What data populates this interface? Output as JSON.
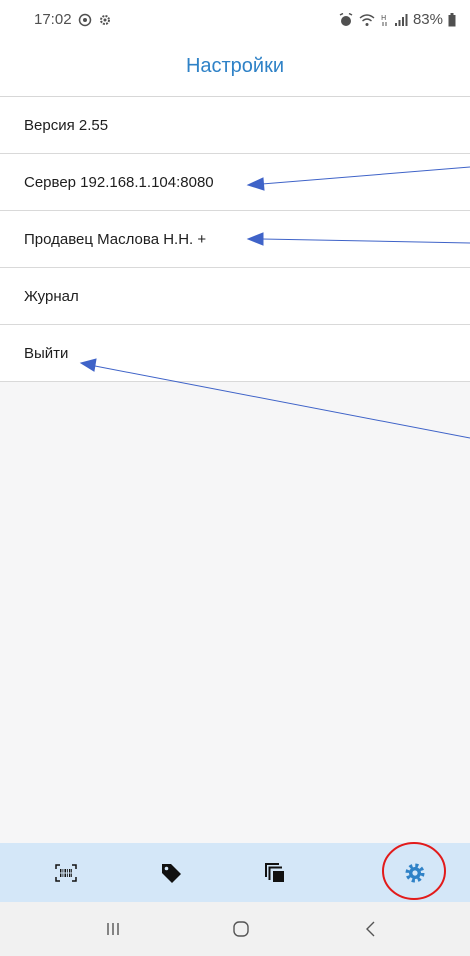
{
  "status_bar": {
    "time": "17:02",
    "icons_left": [
      "whatsapp-icon",
      "settings-small-icon"
    ],
    "icons_right": [
      "alarm-icon",
      "wifi-icon",
      "h-plus-icon",
      "signal-icon"
    ],
    "battery": "83%"
  },
  "header": {
    "title": "Настройки"
  },
  "menu": {
    "items": [
      {
        "label": "Версия 2.55"
      },
      {
        "label": "Сервер 192.168.1.104:8080"
      },
      {
        "label": "Продавец Маслова Н.Н. +"
      },
      {
        "label": "Журнал"
      },
      {
        "label": "Выйти"
      }
    ]
  },
  "bottom_nav": {
    "items": [
      {
        "icon": "barcode-scan-icon"
      },
      {
        "icon": "tag-icon"
      },
      {
        "icon": "copy-icon"
      },
      {
        "icon": "settings-icon",
        "active": true
      }
    ]
  },
  "system_nav": {
    "items": [
      {
        "icon": "recent-apps-icon"
      },
      {
        "icon": "home-icon"
      },
      {
        "icon": "back-icon"
      }
    ]
  },
  "colors": {
    "accent": "#2f82c7",
    "annotation_arrow": "#3f63c8",
    "highlight_circle": "#e21b1b",
    "bottom_nav_bg": "#d4e7f8"
  }
}
